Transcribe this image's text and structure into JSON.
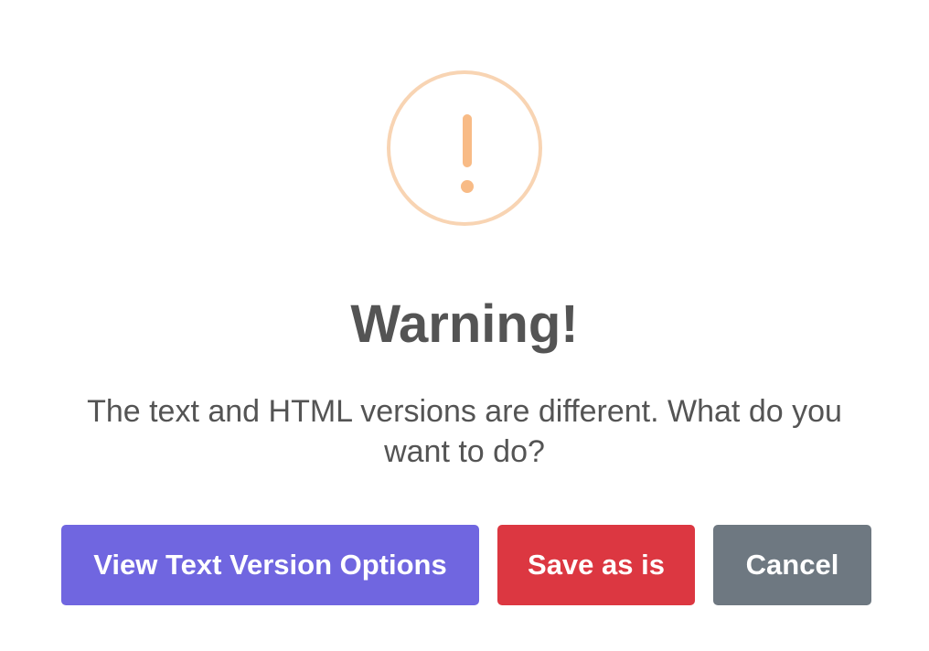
{
  "dialog": {
    "icon": "warning-exclamation-icon",
    "title": "Warning!",
    "message": "The text and HTML versions are different. What do you want to do?",
    "colors": {
      "icon_ring": "#f8d4b3",
      "icon_mark": "#f8bb86",
      "text": "#545454"
    }
  },
  "actions": {
    "view_text_label": "View Text Version Options",
    "save_label": "Save as is",
    "cancel_label": "Cancel",
    "colors": {
      "primary": "#7066e0",
      "danger": "#dc3741",
      "cancel": "#6e7881"
    }
  }
}
